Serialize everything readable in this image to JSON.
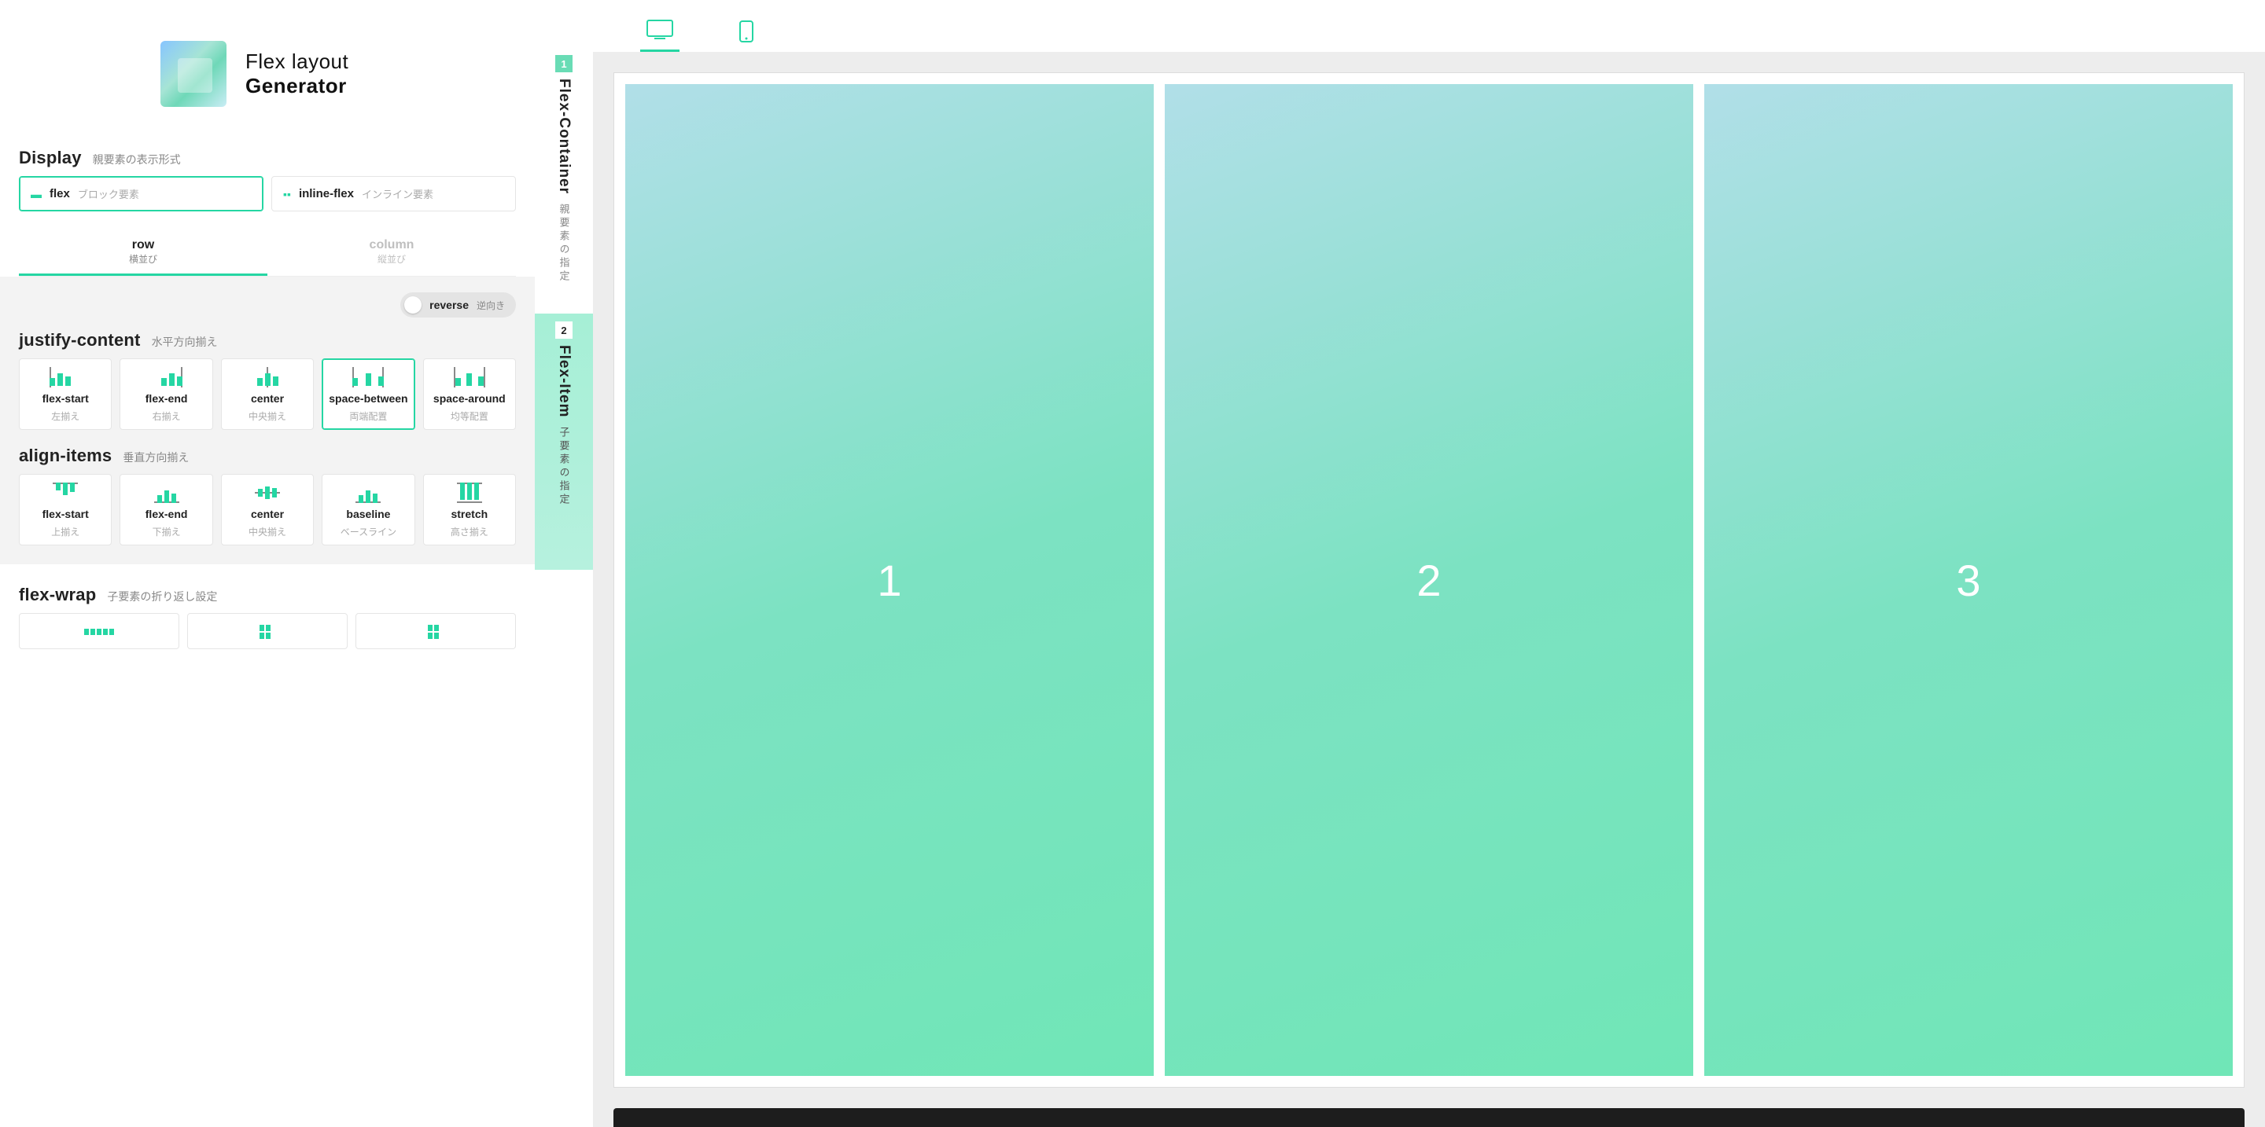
{
  "app": {
    "title_thin": "Flex layout",
    "title_bold": "Generator"
  },
  "sections": {
    "display": {
      "title": "Display",
      "sub": "親要素の表示形式"
    },
    "justify": {
      "title": "justify-content",
      "sub": "水平方向揃え"
    },
    "align": {
      "title": "align-items",
      "sub": "垂直方向揃え"
    },
    "wrap": {
      "title": "flex-wrap",
      "sub": "子要素の折り返し設定"
    }
  },
  "display_opts": [
    {
      "value": "flex",
      "sub": "ブロック要素",
      "selected": true
    },
    {
      "value": "inline-flex",
      "sub": "インライン要素",
      "selected": false
    }
  ],
  "direction_tabs": [
    {
      "value": "row",
      "sub": "横並び",
      "active": true
    },
    {
      "value": "column",
      "sub": "縦並び",
      "active": false
    }
  ],
  "reverse": {
    "label": "reverse",
    "sub": "逆向き",
    "on": false
  },
  "justify_opts": [
    {
      "value": "flex-start",
      "sub": "左揃え"
    },
    {
      "value": "flex-end",
      "sub": "右揃え"
    },
    {
      "value": "center",
      "sub": "中央揃え"
    },
    {
      "value": "space-between",
      "sub": "両端配置",
      "selected": true
    },
    {
      "value": "space-around",
      "sub": "均等配置"
    }
  ],
  "align_opts": [
    {
      "value": "flex-start",
      "sub": "上揃え"
    },
    {
      "value": "flex-end",
      "sub": "下揃え"
    },
    {
      "value": "center",
      "sub": "中央揃え"
    },
    {
      "value": "baseline",
      "sub": "ベースライン"
    },
    {
      "value": "stretch",
      "sub": "高さ揃え"
    }
  ],
  "side_sections": [
    {
      "num": "1",
      "title": "Flex-Container",
      "sub": "親要素の指定"
    },
    {
      "num": "2",
      "title": "Flex-Item",
      "sub": "子要素の指定"
    }
  ],
  "preview_items": [
    "1",
    "2",
    "3"
  ],
  "devices": {
    "desktop_active": true
  }
}
